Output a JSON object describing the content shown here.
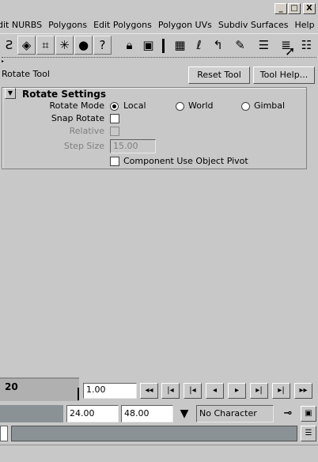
{
  "window": {
    "minimize": "_",
    "maximize": "□",
    "close": "X"
  },
  "menu": [
    "dit NURBS",
    "Polygons",
    "Edit Polygons",
    "Polygon UVs",
    "Subdiv Surfaces",
    "Help"
  ],
  "tool_header": {
    "title": "Rotate Tool",
    "reset_label": "Reset Tool",
    "help_label": "Tool Help..."
  },
  "rotate_settings": {
    "section_title": "Rotate Settings",
    "rotate_mode_label": "Rotate Mode",
    "modes": [
      "Local",
      "World",
      "Gimbal"
    ],
    "selected_mode": "Local",
    "snap_rotate_label": "Snap Rotate",
    "relative_label": "Relative",
    "step_size_label": "Step Size",
    "step_size_value": "15.00",
    "component_pivot_label": "Component Use Object Pivot"
  },
  "timeline": {
    "current_frame_marker": "20",
    "current_time": "1.00",
    "range_start": "24.00",
    "range_end": "48.00",
    "character_set": "No Character Set"
  },
  "icons": {
    "play_prev_key": "◂◂",
    "step_back": "|◂",
    "go_start": "|◂",
    "play_back": "◂",
    "play_forward": "▸",
    "go_end": "▸|",
    "step_forward": "▸|",
    "play_next_key": "▸▸"
  }
}
